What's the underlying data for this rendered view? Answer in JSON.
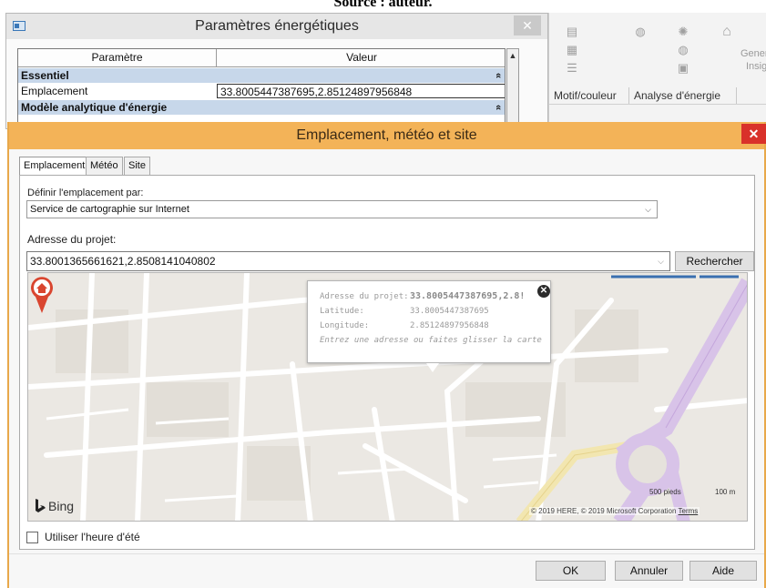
{
  "caption": "Source : auteur.",
  "energy_panel": {
    "title": "Paramètres énergétiques",
    "close_glyph": "✕",
    "table": {
      "col_param": "Paramètre",
      "col_value": "Valeur",
      "rows": [
        {
          "kind": "group",
          "label": "Essentiel"
        },
        {
          "kind": "param",
          "name": "Emplacement",
          "value": "33.8005447387695,2.85124897956848"
        },
        {
          "kind": "group",
          "label": "Modèle analytique d'énergie"
        }
      ],
      "collapse_glyph": "«"
    }
  },
  "ribbon": {
    "labels": [
      "Motif/couleur",
      "Analyse d'énergie"
    ],
    "partial_text_1": "Gener",
    "partial_text_2": "Insig"
  },
  "dialog": {
    "title": "Emplacement, météo et site",
    "close_glyph": "✕",
    "tabs": [
      {
        "label": "Emplacement",
        "active": true
      },
      {
        "label": "Météo",
        "active": false
      },
      {
        "label": "Site",
        "active": false
      }
    ],
    "define_by_label": "Définir l'emplacement par:",
    "define_by_value": "Service de cartographie sur Internet",
    "address_label": "Adresse du projet:",
    "address_value": "33.8001365661621,2.8508141040802",
    "search_button": "Rechercher",
    "map": {
      "popup": {
        "address_key": "Adresse du projet:",
        "address_value": "33.8005447387695,2.8!",
        "lat_key": "Latitude:",
        "lat_value": "33.8005447387695",
        "lon_key": "Longitude:",
        "lon_value": "2.85124897956848",
        "hint": "Entrez une adresse ou faites glisser la carte pc"
      },
      "brand": "Bing",
      "scale_feet": "500 pieds",
      "scale_m": "100 m",
      "attribution": "© 2019 HERE, © 2019 Microsoft Corporation",
      "terms": "Terms"
    },
    "dst_label": "Utiliser l'heure d'été",
    "dst_checked": false,
    "buttons": {
      "ok": "OK",
      "cancel": "Annuler",
      "help": "Aide"
    }
  }
}
